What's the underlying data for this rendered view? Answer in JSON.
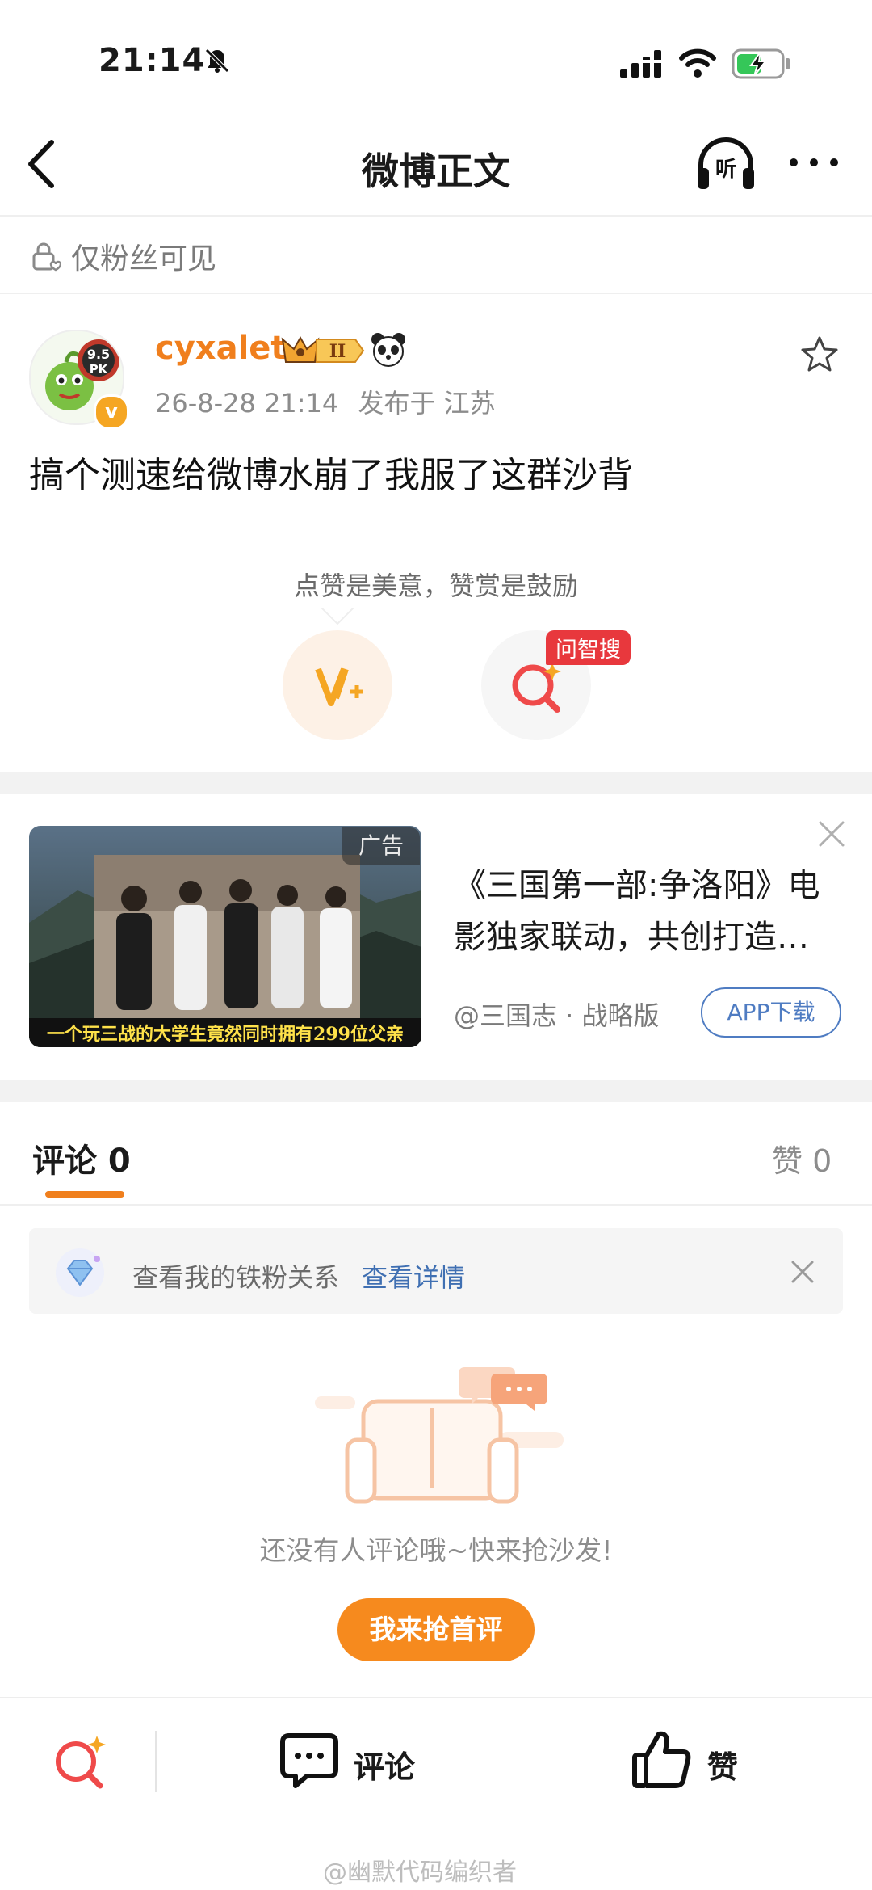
{
  "status_bar": {
    "time": "21:14"
  },
  "nav": {
    "title": "微博正文"
  },
  "visibility": {
    "label": "仅粉丝可见"
  },
  "post": {
    "author": "cyxalet",
    "vip_level": "II",
    "avatar_badge_top": "9.5",
    "avatar_badge_bottom": "PK",
    "verified_mark": "v",
    "date": "26-8-28 21:14",
    "location": "发布于 江苏",
    "text": "搞个测速给微博水崩了我服了这群沙背"
  },
  "reward": {
    "tip": "点赞是美意，赞赏是鼓励",
    "ask_badge": "问智搜"
  },
  "ad": {
    "tag": "广告",
    "caption": "一个玩三战的大学生竟然同时拥有299位父亲",
    "title": "《三国第一部:争洛阳》电影独家联动，共创打造…",
    "source": "@三国志 · 战略版",
    "button": "APP下载"
  },
  "tabs": {
    "comments": "评论 0",
    "likes": "赞 0"
  },
  "fan_bar": {
    "text": "查看我的铁粉关系",
    "link": "查看详情"
  },
  "empty": {
    "text": "还没有人评论哦~快来抢沙发!",
    "button": "我来抢首评"
  },
  "bottom_bar": {
    "comment": "评论",
    "like": "赞"
  },
  "watermark": "@幽默代码编织者",
  "colors": {
    "accent_orange": "#f07f1d",
    "button_orange": "#f68a1e",
    "link_blue": "#3f6fb2",
    "ask_red": "#e8383d"
  },
  "icons": [
    "bell-off-icon",
    "signal-icon",
    "wifi-icon",
    "battery-charging-icon",
    "back-icon",
    "listen-icon",
    "more-icon",
    "lock-icon",
    "star-icon",
    "reward-icon",
    "ai-search-icon",
    "close-icon",
    "sofa-icon",
    "comment-icon",
    "like-icon"
  ]
}
